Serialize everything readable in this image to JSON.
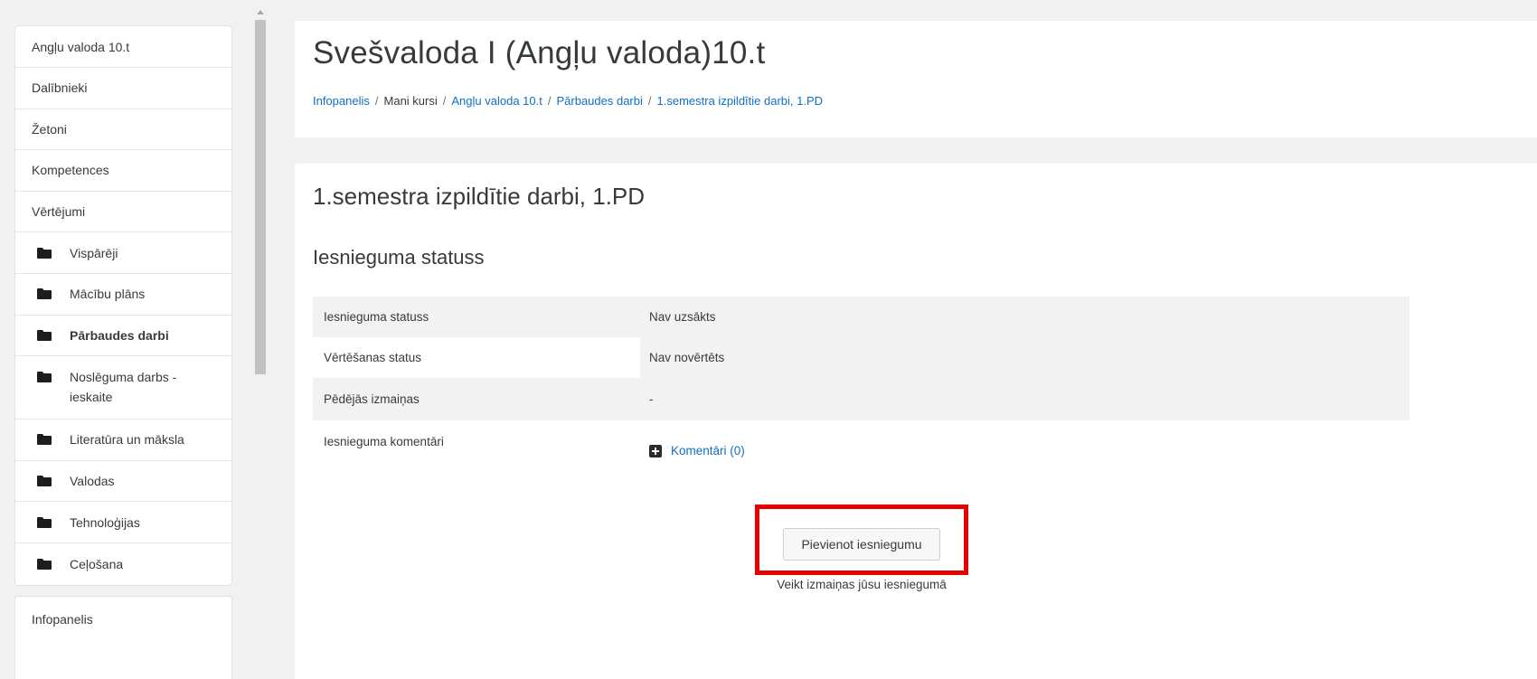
{
  "sidebar": {
    "items": [
      {
        "label": "Angļu valoda 10.t"
      },
      {
        "label": "Dalībnieki"
      },
      {
        "label": "Žetoni"
      },
      {
        "label": "Kompetences"
      },
      {
        "label": "Vērtējumi"
      },
      {
        "label": "Vispārēji",
        "icon": "folder-icon"
      },
      {
        "label": "Mācību plāns",
        "icon": "folder-icon"
      },
      {
        "label": "Pārbaudes darbi",
        "icon": "folder-icon",
        "active": true
      },
      {
        "label": "Noslēguma darbs - ieskaite",
        "icon": "folder-icon"
      },
      {
        "label": "Literatūra un māksla",
        "icon": "folder-icon"
      },
      {
        "label": "Valodas",
        "icon": "folder-icon"
      },
      {
        "label": "Tehnoloģijas",
        "icon": "folder-icon"
      },
      {
        "label": "Ceļošana",
        "icon": "folder-icon"
      }
    ],
    "secondary": {
      "label": "Infopanelis"
    }
  },
  "header": {
    "title": "Svešvaloda I (Angļu valoda)10.t",
    "breadcrumb": [
      {
        "label": "Infopanelis",
        "link": true
      },
      {
        "label": "Mani kursi",
        "link": false
      },
      {
        "label": "Angļu valoda 10.t",
        "link": true
      },
      {
        "label": "Pārbaudes darbi",
        "link": true
      },
      {
        "label": "1.semestra izpildītie darbi, 1.PD",
        "link": true
      }
    ],
    "separator": "/"
  },
  "main": {
    "activity_title": "1.semestra izpildītie darbi, 1.PD",
    "section_title": "Iesnieguma statuss",
    "rows": [
      {
        "label": "Iesnieguma statuss",
        "value": "Nav uzsākts"
      },
      {
        "label": "Vērtēšanas status",
        "value": "Nav novērtēts"
      },
      {
        "label": "Pēdējās izmaiņas",
        "value": "-"
      },
      {
        "label": "Iesnieguma komentāri",
        "value": "Komentāri (0)"
      }
    ],
    "submit_button": "Pievienot iesniegumu",
    "submit_hint": "Veikt izmaiņas jūsu iesniegumā"
  },
  "colors": {
    "link": "#0f6fc5",
    "highlight": "#e60000",
    "shaded_row": "#f2f2f2"
  }
}
